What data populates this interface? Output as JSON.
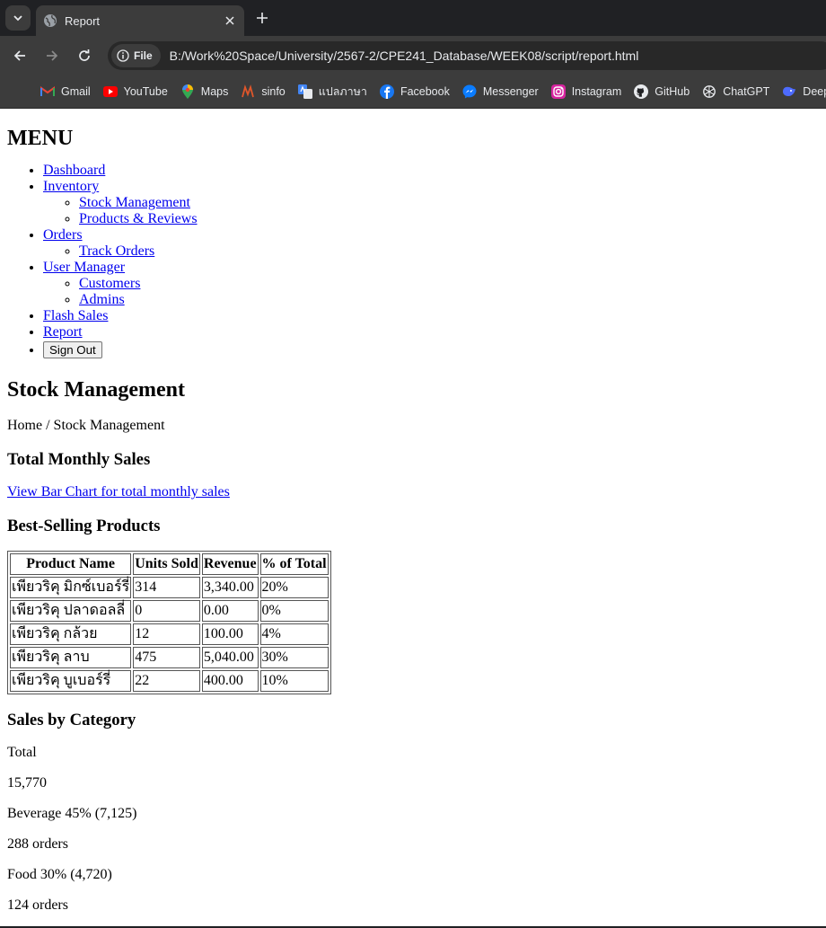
{
  "browser": {
    "tab_title": "Report",
    "site_chip": "File",
    "url": "B:/Work%20Space/University/2567-2/CPE241_Database/WEEK08/script/report.html",
    "bookmarks": [
      {
        "label": "Gmail",
        "icon": "gmail-icon"
      },
      {
        "label": "YouTube",
        "icon": "youtube-icon"
      },
      {
        "label": "Maps",
        "icon": "maps-icon"
      },
      {
        "label": "sinfo",
        "icon": "sinfo-icon"
      },
      {
        "label": "แปลภาษา",
        "icon": "translate-icon"
      },
      {
        "label": "Facebook",
        "icon": "facebook-icon"
      },
      {
        "label": "Messenger",
        "icon": "messenger-icon"
      },
      {
        "label": "Instagram",
        "icon": "instagram-icon"
      },
      {
        "label": "GitHub",
        "icon": "github-icon"
      },
      {
        "label": "ChatGPT",
        "icon": "chatgpt-icon"
      },
      {
        "label": "Deep",
        "icon": "deepseek-icon"
      }
    ]
  },
  "menu": {
    "title": "MENU",
    "items": [
      {
        "label": "Dashboard",
        "children": []
      },
      {
        "label": "Inventory",
        "children": [
          "Stock Management",
          "Products & Reviews"
        ]
      },
      {
        "label": "Orders",
        "children": [
          "Track Orders"
        ]
      },
      {
        "label": "User Manager",
        "children": [
          "Customers",
          "Admins"
        ]
      },
      {
        "label": "Flash Sales",
        "children": []
      },
      {
        "label": "Report",
        "children": []
      }
    ],
    "sign_out": "Sign Out"
  },
  "main": {
    "title": "Stock Management",
    "breadcrumb": "Home / Stock Management",
    "monthly_heading": "Total Monthly Sales",
    "monthly_link": "View Bar Chart for total monthly sales",
    "best_heading": "Best-Selling Products",
    "table": {
      "headers": [
        "Product Name",
        "Units Sold",
        "Revenue",
        "% of Total"
      ],
      "rows": [
        [
          "เพียวริคุ มิกซ์เบอร์รี่",
          "314",
          "3,340.00",
          "20%"
        ],
        [
          "เพียวริคุ ปลาดอลลี่",
          "0",
          "0.00",
          "0%"
        ],
        [
          "เพียวริคุ กล้วย",
          "12",
          "100.00",
          "4%"
        ],
        [
          "เพียวริคุ ลาบ",
          "475",
          "5,040.00",
          "30%"
        ],
        [
          "เพียวริคุ บูเบอร์รี่",
          "22",
          "400.00",
          "10%"
        ]
      ]
    },
    "category_heading": "Sales by Category",
    "total_label": "Total",
    "total_value": "15,770",
    "categories": [
      {
        "line": "Beverage 45% (7,125)",
        "orders": "288 orders"
      },
      {
        "line": "Food 30% (4,720)",
        "orders": "124 orders"
      }
    ]
  }
}
